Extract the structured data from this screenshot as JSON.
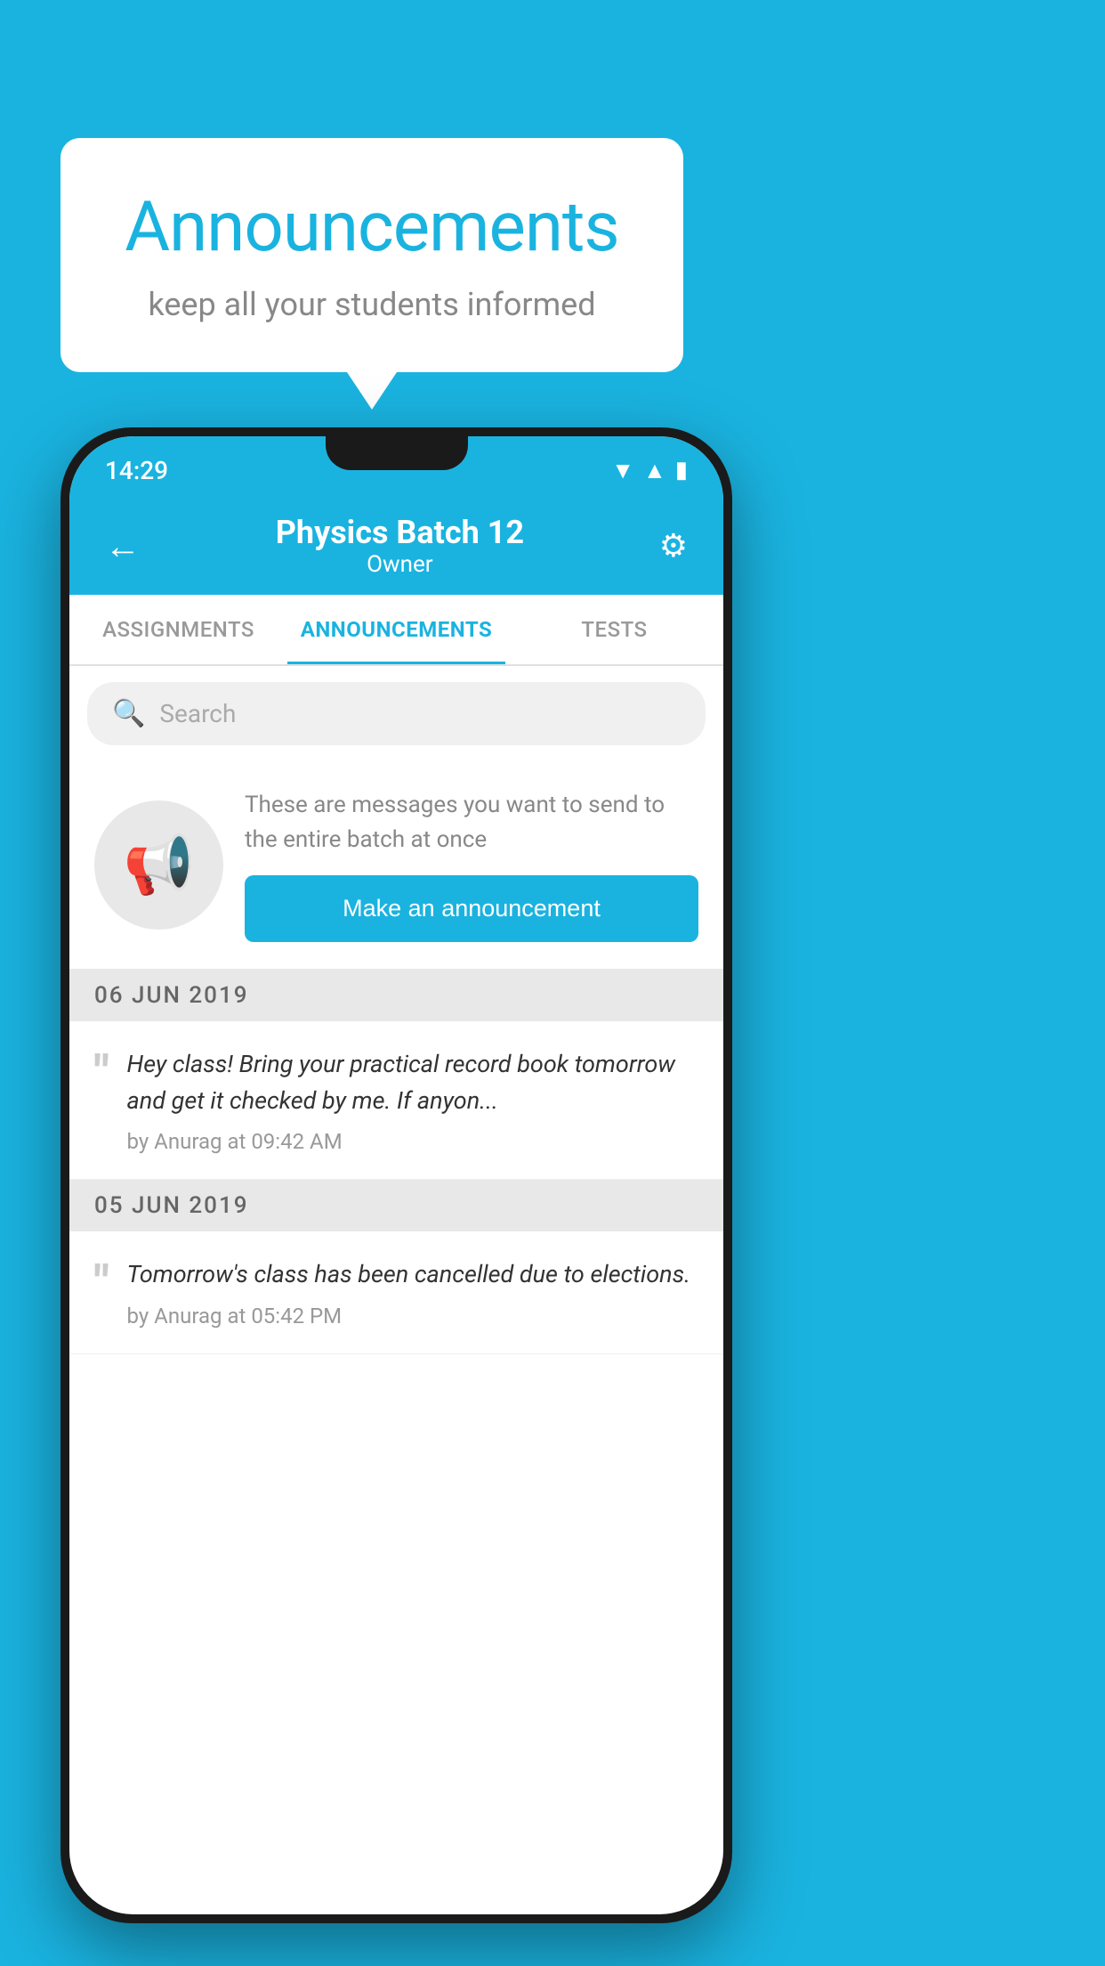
{
  "background_color": "#1ab3e0",
  "speech_bubble": {
    "title": "Announcements",
    "subtitle": "keep all your students informed"
  },
  "phone": {
    "status_bar": {
      "time": "14:29"
    },
    "app_bar": {
      "batch_name": "Physics Batch 12",
      "owner_label": "Owner",
      "back_icon": "←",
      "settings_icon": "⚙"
    },
    "tabs": [
      {
        "label": "ASSIGNMENTS",
        "active": false
      },
      {
        "label": "ANNOUNCEMENTS",
        "active": true
      },
      {
        "label": "TESTS",
        "active": false
      }
    ],
    "search": {
      "placeholder": "Search"
    },
    "promo": {
      "description": "These are messages you want to send to the entire batch at once",
      "button_label": "Make an announcement"
    },
    "announcement_groups": [
      {
        "date": "06  JUN  2019",
        "items": [
          {
            "text": "Hey class! Bring your practical record book tomorrow and get it checked by me. If anyon...",
            "meta": "by Anurag at 09:42 AM"
          }
        ]
      },
      {
        "date": "05  JUN  2019",
        "items": [
          {
            "text": "Tomorrow's class has been cancelled due to elections.",
            "meta": "by Anurag at 05:42 PM"
          }
        ]
      }
    ]
  }
}
